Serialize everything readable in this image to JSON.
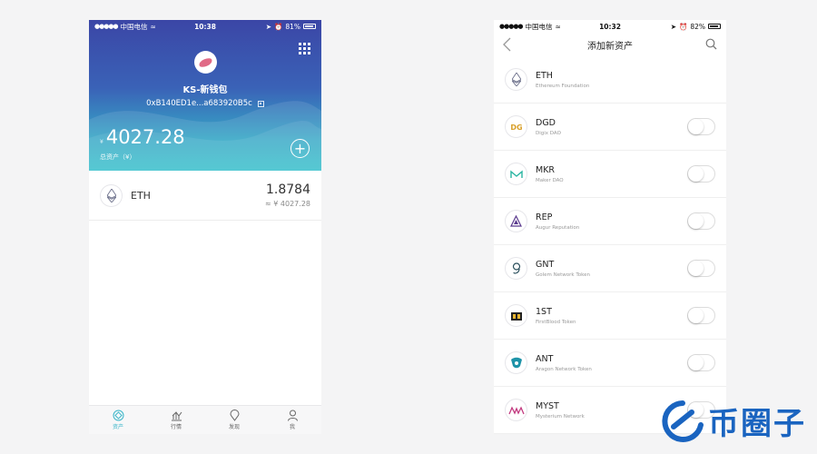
{
  "colors": {
    "accent": "#3ab6c9",
    "header_top": "#3b46a6",
    "header_bottom": "#34bfcb",
    "watermark": "#1a64c0"
  },
  "left_phone": {
    "status": {
      "carrier": "中国电信",
      "time": "10:38",
      "battery": "81%"
    },
    "wallet": {
      "name": "KS-新钱包",
      "address": "0xB140ED1e...a683920B5c",
      "currency_symbol": "¥",
      "balance": "4027.28",
      "total_label": "总资产（¥）"
    },
    "assets": [
      {
        "symbol": "ETH",
        "amount": "1.8784",
        "cny_prefix": "≈",
        "cny_value": "¥ 4027.28",
        "icon": "eth-icon"
      }
    ],
    "tabs": [
      {
        "label": "资产",
        "icon": "wallet-tab-icon",
        "active": true
      },
      {
        "label": "行情",
        "icon": "chart-tab-icon",
        "active": false
      },
      {
        "label": "发现",
        "icon": "location-tab-icon",
        "active": false
      },
      {
        "label": "我",
        "icon": "user-tab-icon",
        "active": false
      }
    ]
  },
  "right_phone": {
    "status": {
      "carrier": "中国电信",
      "time": "10:32",
      "battery": "82%"
    },
    "title": "添加新资产",
    "tokens": [
      {
        "symbol": "ETH",
        "name": "Ethereum Foundation",
        "toggle": false,
        "has_toggle": false
      },
      {
        "symbol": "DGD",
        "name": "Digix DAO",
        "toggle": false,
        "has_toggle": true
      },
      {
        "symbol": "MKR",
        "name": "Maker DAO",
        "toggle": false,
        "has_toggle": true
      },
      {
        "symbol": "REP",
        "name": "Augur Reputation",
        "toggle": false,
        "has_toggle": true
      },
      {
        "symbol": "GNT",
        "name": "Golem Network Token",
        "toggle": false,
        "has_toggle": true
      },
      {
        "symbol": "1ST",
        "name": "FirstBlood Token",
        "toggle": false,
        "has_toggle": true
      },
      {
        "symbol": "ANT",
        "name": "Aragon Network Token",
        "toggle": false,
        "has_toggle": true
      },
      {
        "symbol": "MYST",
        "name": "Mysterium Network",
        "toggle": false,
        "has_toggle": true
      }
    ]
  },
  "watermark": {
    "text": "币圈子"
  }
}
